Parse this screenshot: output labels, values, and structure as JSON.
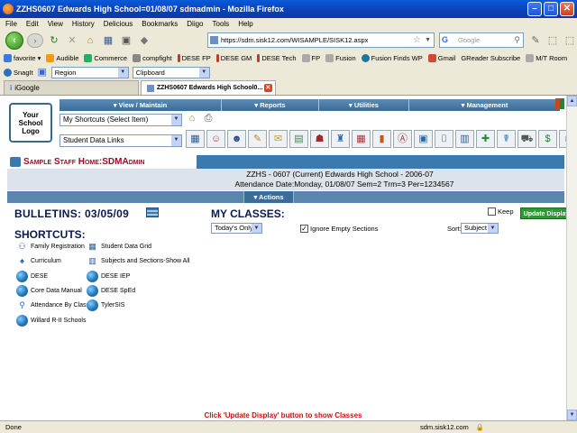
{
  "window": {
    "title": "ZZHS0607 Edwards High School=01/08/07  sdmadmin - Mozilla Firefox"
  },
  "menu": [
    "File",
    "Edit",
    "View",
    "History",
    "Delicious",
    "Bookmarks",
    "Diigo",
    "Tools",
    "Help"
  ],
  "nav": {
    "url": "https://sdm.sisk12.com/WISAMPLE/SISK12.aspx",
    "search_placeholder": "Google"
  },
  "bookmarks": [
    "favorite",
    "Audible",
    "Commerce",
    "compfight",
    "DESE FP",
    "DESE GM",
    "DESE Tech",
    "FP",
    "Fusion",
    "Fusion Finds WP",
    "Gmail",
    "GReader Subscribe",
    "M/T Room"
  ],
  "toolbar2": {
    "snagit": "SnagIt",
    "region": "Region",
    "clipboard": "Clipboard"
  },
  "tabs": [
    {
      "label": "iGoogle"
    },
    {
      "label": "ZZHS0607 Edwards High School0..."
    }
  ],
  "page": {
    "logo": [
      "Your",
      "School",
      "Logo"
    ],
    "topnav": [
      "View / Maintain",
      "Reports",
      "Utilities",
      "Management"
    ],
    "shortcuts_select": "My Shortcuts (Select Item)",
    "links_select": "Student Data Links",
    "home_title": "Sample Staff Home:SDMAdmin",
    "info_line1": "ZZHS - 0607 (Current) Edwards High School - 2006-07",
    "info_line2": "Attendance Date:Monday, 01/08/07 Sem=2 Trm=3 Per=1234567",
    "actions": "Actions",
    "bulletins": "BULLETINS: 03/05/09",
    "my_classes": "MY CLASSES:",
    "keep": "Keep",
    "update_display": "Update Display",
    "todays_only": "Today's Only",
    "ignore_empty": "Ignore Empty Sections",
    "sort_label": "Sort:",
    "sort_value": "Subject",
    "shortcuts_heading": "SHORTCUTS:",
    "shortcuts_left": [
      "Family Registration",
      "Curriculum",
      "DESE",
      "Core Data Manual",
      "Attendance By Class",
      "Willard R-II Schools"
    ],
    "shortcuts_right": [
      "Student Data Grid",
      "Subjects and Sections-Show All",
      "DESE IEP",
      "DESE SpEd",
      "TylerSIS"
    ],
    "message": "Click 'Update Display' button to show Classes"
  },
  "status": {
    "left": "Done",
    "domain": "sdm.sisk12.com"
  }
}
